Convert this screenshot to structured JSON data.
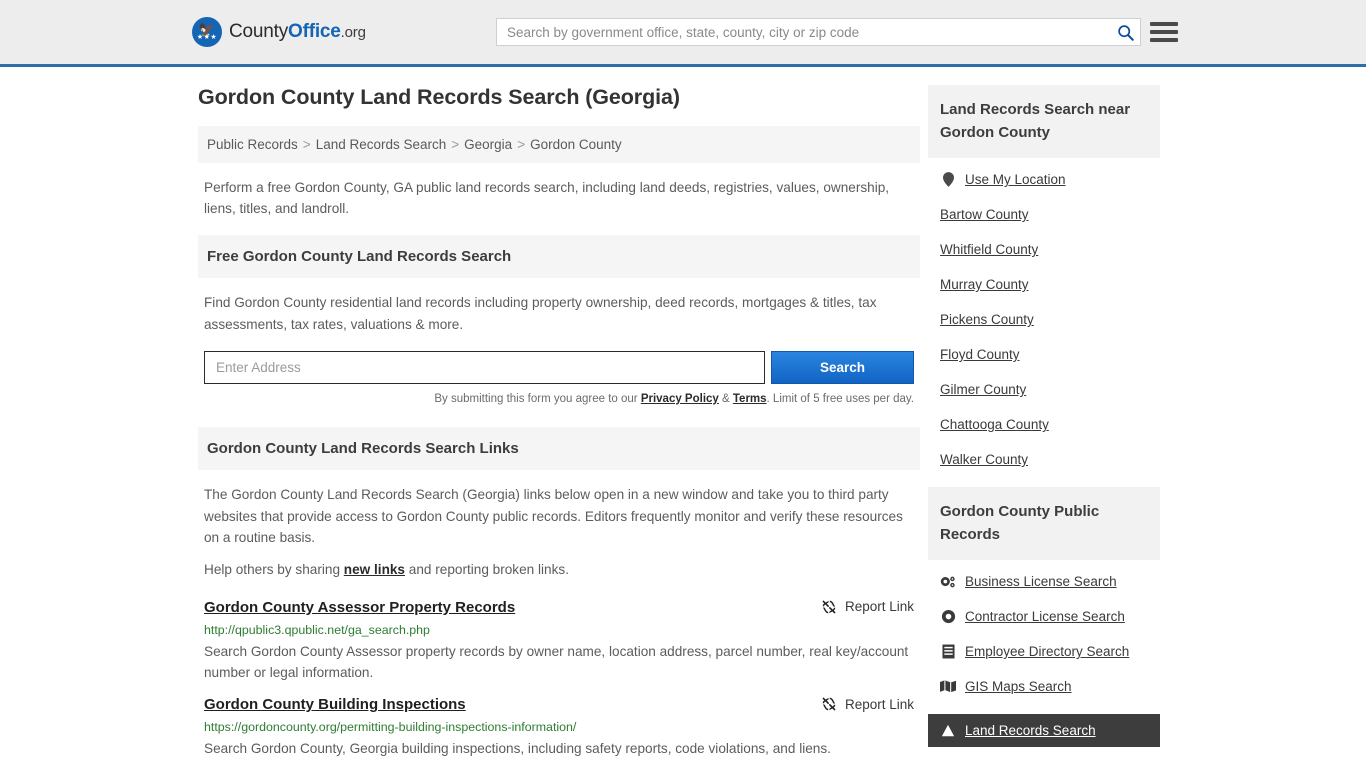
{
  "header": {
    "logo": {
      "part1": "County",
      "part2": "Office",
      "part3": ".org",
      "icon": "eagle-badge-icon"
    },
    "search_placeholder": "Search by government office, state, county, city or zip code",
    "search_value": "",
    "search_icon": "search-icon",
    "menu_icon": "hamburger-menu-icon",
    "accent_color": "#2f6fa7"
  },
  "main": {
    "page_title": "Gordon County Land Records Search (Georgia)",
    "breadcrumb": [
      "Public Records",
      "Land Records Search",
      "Georgia",
      "Gordon County"
    ],
    "breadcrumb_separator": ">",
    "intro": "Perform a free Gordon County, GA public land records search, including land deeds, registries, values, ownership, liens, titles, and landroll.",
    "free_search": {
      "heading": "Free Gordon County Land Records Search",
      "description": "Find Gordon County residential land records including property ownership, deed records, mortgages & titles, tax assessments, tax rates, valuations & more.",
      "input_placeholder": "Enter Address",
      "input_value": "",
      "button_label": "Search",
      "note_prefix": "By submitting this form you agree to our ",
      "note_privacy": "Privacy Policy",
      "note_amp": " & ",
      "note_terms": "Terms",
      "note_suffix": ". Limit of 5 free uses per day."
    },
    "links_section": {
      "heading": "Gordon County Land Records Search Links",
      "paragraph": "The Gordon County Land Records Search (Georgia) links below open in a new window and take you to third party websites that provide access to Gordon County public records. Editors frequently monitor and verify these resources on a routine basis.",
      "help_prefix": "Help others by sharing ",
      "help_link": "new links",
      "help_suffix": " and reporting broken links.",
      "report_label": "Report Link",
      "report_icon": "broken-link-icon",
      "results": [
        {
          "title": "Gordon County Assessor Property Records",
          "url": "http://qpublic3.qpublic.net/ga_search.php",
          "description": "Search Gordon County Assessor property records by owner name, location address, parcel number, real key/account number or legal information."
        },
        {
          "title": "Gordon County Building Inspections",
          "url": "https://gordoncounty.org/permitting-building-inspections-information/",
          "description": "Search Gordon County, Georgia building inspections, including safety reports, code violations, and liens."
        }
      ]
    }
  },
  "sidebar": {
    "nearby": {
      "heading": "Land Records Search near Gordon County",
      "items": [
        {
          "label": "Use My Location",
          "icon": "map-pin-icon"
        },
        {
          "label": "Bartow County",
          "icon": ""
        },
        {
          "label": "Whitfield County",
          "icon": ""
        },
        {
          "label": "Murray County",
          "icon": ""
        },
        {
          "label": "Pickens County",
          "icon": ""
        },
        {
          "label": "Floyd County",
          "icon": ""
        },
        {
          "label": "Gilmer County",
          "icon": ""
        },
        {
          "label": "Chattooga County",
          "icon": ""
        },
        {
          "label": "Walker County",
          "icon": ""
        }
      ]
    },
    "public_records": {
      "heading": "Gordon County Public Records",
      "items": [
        {
          "label": "Business License Search",
          "icon": "gears-icon",
          "active": false
        },
        {
          "label": "Contractor License Search",
          "icon": "gear-icon",
          "active": false
        },
        {
          "label": "Employee Directory Search",
          "icon": "document-icon",
          "active": false
        },
        {
          "label": "GIS Maps Search",
          "icon": "map-icon",
          "active": false
        },
        {
          "label": "Land Records Search",
          "icon": "land-icon",
          "active": true
        }
      ]
    }
  }
}
